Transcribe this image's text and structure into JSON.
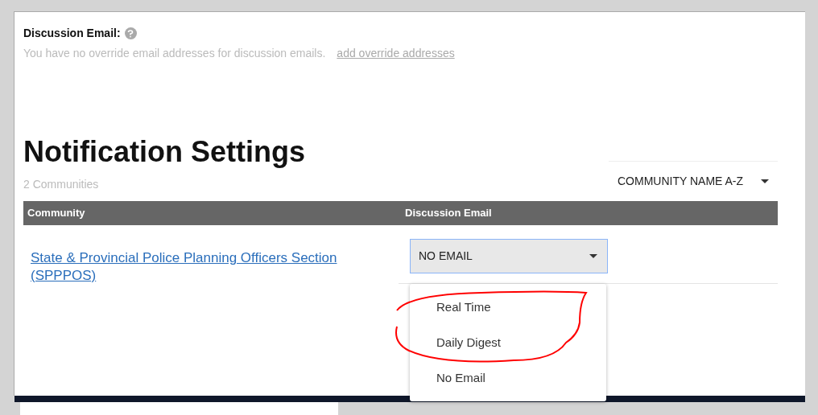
{
  "discussion_email": {
    "label": "Discussion Email:",
    "message": "You have no override email addresses for discussion emails.",
    "link": "add override addresses"
  },
  "heading": "Notification Settings",
  "count": "2 Communities",
  "sort": {
    "value": "COMMUNITY NAME A-Z"
  },
  "table": {
    "columns": [
      "Community",
      "Discussion Email"
    ],
    "rows": [
      {
        "community": "State & Provincial Police Planning Officers Section (SPPPOS)",
        "discussion_email": "NO EMAIL"
      }
    ]
  },
  "dropdown_menu": {
    "items": [
      {
        "label": "Real Time",
        "selected": false
      },
      {
        "label": "Daily Digest",
        "selected": false
      },
      {
        "label": "No Email",
        "selected": false
      }
    ]
  }
}
